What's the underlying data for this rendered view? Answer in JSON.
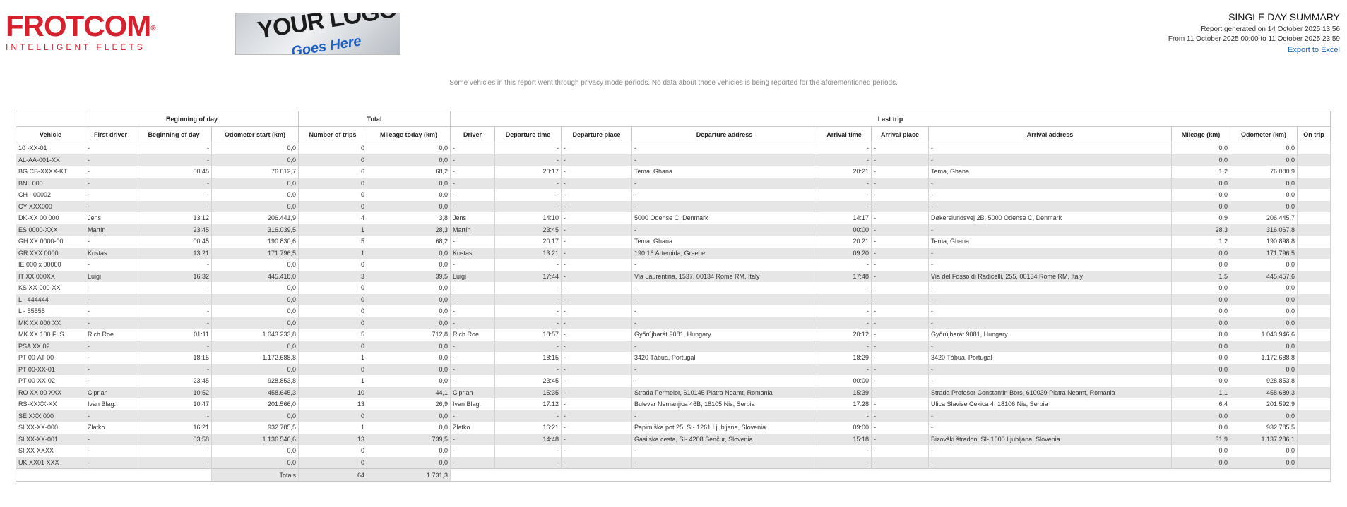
{
  "brand": {
    "name": "FROTCOM",
    "reg": "®",
    "tagline": "INTELLIGENT FLEETS"
  },
  "logo_placeholder": {
    "line1": "YOUR LOGO",
    "line2": "Goes Here"
  },
  "report": {
    "title": "SINGLE DAY SUMMARY",
    "generated": "Report generated on 14 October 2025 13:56",
    "range": "From 11 October 2025 00:00 to 11 October 2025 23:59",
    "export_label": "Export to Excel"
  },
  "notice": "Some vehicles in this report went through privacy mode periods. No data about those vehicles is being reported for the aforementioned periods.",
  "table": {
    "groups": {
      "beginning": "Beginning of day",
      "total": "Total",
      "last_trip": "Last trip"
    },
    "columns": [
      "Vehicle",
      "First driver",
      "Beginning of day",
      "Odometer start (km)",
      "Number of trips",
      "Mileage today (km)",
      "Driver",
      "Departure time",
      "Departure place",
      "Departure address",
      "Arrival time",
      "Arrival place",
      "Arrival address",
      "Mileage (km)",
      "Odometer (km)",
      "On trip"
    ],
    "rows": [
      [
        "10 -XX-01",
        "-",
        "-",
        "0,0",
        "0",
        "0,0",
        "-",
        "-",
        "-",
        "-",
        "-",
        "-",
        "-",
        "0,0",
        "0,0",
        ""
      ],
      [
        "AL-AA-001-XX",
        "-",
        "-",
        "0,0",
        "0",
        "0,0",
        "-",
        "-",
        "-",
        "-",
        "-",
        "-",
        "-",
        "0,0",
        "0,0",
        ""
      ],
      [
        "BG CB-XXXX-KT",
        "-",
        "00:45",
        "76.012,7",
        "6",
        "68,2",
        "-",
        "20:17",
        "-",
        "Tema, Ghana",
        "20:21",
        "-",
        "Tema, Ghana",
        "1,2",
        "76.080,9",
        ""
      ],
      [
        "BNL 000",
        "-",
        "-",
        "0,0",
        "0",
        "0,0",
        "-",
        "-",
        "-",
        "-",
        "-",
        "-",
        "-",
        "0,0",
        "0,0",
        ""
      ],
      [
        "CH - 00002",
        "-",
        "-",
        "0,0",
        "0",
        "0,0",
        "-",
        "-",
        "-",
        "-",
        "-",
        "-",
        "-",
        "0,0",
        "0,0",
        ""
      ],
      [
        "CY XXX000",
        "-",
        "-",
        "0,0",
        "0",
        "0,0",
        "-",
        "-",
        "-",
        "-",
        "-",
        "-",
        "-",
        "0,0",
        "0,0",
        ""
      ],
      [
        "DK-XX 00 000",
        "Jens",
        "13:12",
        "206.441,9",
        "4",
        "3,8",
        "Jens",
        "14:10",
        "-",
        "5000 Odense C, Denmark",
        "14:17",
        "-",
        "Døkerslundsvej 2B, 5000 Odense C, Denmark",
        "0,9",
        "206.445,7",
        ""
      ],
      [
        "ES 0000-XXX",
        "Martín",
        "23:45",
        "316.039,5",
        "1",
        "28,3",
        "Martín",
        "23:45",
        "-",
        "-",
        "00:00",
        "-",
        "-",
        "28,3",
        "316.067,8",
        ""
      ],
      [
        "GH XX 0000-00",
        "-",
        "00:45",
        "190.830,6",
        "5",
        "68,2",
        "-",
        "20:17",
        "-",
        "Tema, Ghana",
        "20:21",
        "-",
        "Tema, Ghana",
        "1,2",
        "190.898,8",
        ""
      ],
      [
        "GR XXX 0000",
        "Kostas",
        "13:21",
        "171.796,5",
        "1",
        "0,0",
        "Kostas",
        "13:21",
        "-",
        "190 16 Artemida, Greece",
        "09:20",
        "-",
        "-",
        "0,0",
        "171.796,5",
        ""
      ],
      [
        "IE 000 x 00000",
        "-",
        "-",
        "0,0",
        "0",
        "0,0",
        "-",
        "-",
        "-",
        "-",
        "-",
        "-",
        "-",
        "0,0",
        "0,0",
        ""
      ],
      [
        "IT XX 000XX",
        "Luigi",
        "16:32",
        "445.418,0",
        "3",
        "39,5",
        "Luigi",
        "17:44",
        "-",
        "Via Laurentina, 1537, 00134 Rome RM, Italy",
        "17:48",
        "-",
        "Via del Fosso di Radicelli, 255, 00134 Rome RM, Italy",
        "1,5",
        "445.457,6",
        ""
      ],
      [
        "KS XX-000-XX",
        "-",
        "-",
        "0,0",
        "0",
        "0,0",
        "-",
        "-",
        "-",
        "-",
        "-",
        "-",
        "-",
        "0,0",
        "0,0",
        ""
      ],
      [
        "L - 444444",
        "-",
        "-",
        "0,0",
        "0",
        "0,0",
        "-",
        "-",
        "-",
        "-",
        "-",
        "-",
        "-",
        "0,0",
        "0,0",
        ""
      ],
      [
        "L - 55555",
        "-",
        "-",
        "0,0",
        "0",
        "0,0",
        "-",
        "-",
        "-",
        "-",
        "-",
        "-",
        "-",
        "0,0",
        "0,0",
        ""
      ],
      [
        "MK XX 000 XX",
        "-",
        "-",
        "0,0",
        "0",
        "0,0",
        "-",
        "-",
        "-",
        "-",
        "-",
        "-",
        "-",
        "0,0",
        "0,0",
        ""
      ],
      [
        "MK XX 100 FLS",
        "Rich Roe",
        "01:11",
        "1.043.233,8",
        "5",
        "712,8",
        "Rich Roe",
        "18:57",
        "-",
        "Győrújbarát 9081, Hungary",
        "20:12",
        "-",
        "Győrújbarát 9081, Hungary",
        "0,0",
        "1.043.946,6",
        ""
      ],
      [
        "PSA XX 02",
        "-",
        "-",
        "0,0",
        "0",
        "0,0",
        "-",
        "-",
        "-",
        "-",
        "-",
        "-",
        "-",
        "0,0",
        "0,0",
        ""
      ],
      [
        "PT 00-AT-00",
        "-",
        "18:15",
        "1.172.688,8",
        "1",
        "0,0",
        "-",
        "18:15",
        "-",
        "3420 Tábua, Portugal",
        "18:29",
        "-",
        "3420 Tábua, Portugal",
        "0,0",
        "1.172.688,8",
        ""
      ],
      [
        "PT 00-XX-01",
        "-",
        "-",
        "0,0",
        "0",
        "0,0",
        "-",
        "-",
        "-",
        "-",
        "-",
        "-",
        "-",
        "0,0",
        "0,0",
        ""
      ],
      [
        "PT 00-XX-02",
        "-",
        "23:45",
        "928.853,8",
        "1",
        "0,0",
        "-",
        "23:45",
        "-",
        "-",
        "00:00",
        "-",
        "-",
        "0,0",
        "928.853,8",
        ""
      ],
      [
        "RO XX 00 XXX",
        "Ciprian",
        "10:52",
        "458.645,3",
        "10",
        "44,1",
        "Ciprian",
        "15:35",
        "-",
        "Strada Fermelor, 610145 Piatra Neamt, Romania",
        "15:39",
        "-",
        "Strada Profesor Constantin Bors, 610039 Piatra Neamt, Romania",
        "1,1",
        "458.689,3",
        ""
      ],
      [
        "RS-XXXX-XX",
        "Ivan Blag.",
        "10:47",
        "201.566,0",
        "13",
        "26,9",
        "Ivan Blag.",
        "17:12",
        "-",
        "Bulevar Nemanjica 46B, 18105 Nis, Serbia",
        "17:28",
        "-",
        "Ulica Slavise Cekica 4, 18106 Nis, Serbia",
        "6,4",
        "201.592,9",
        ""
      ],
      [
        "SE XXX 000",
        "-",
        "-",
        "0,0",
        "0",
        "0,0",
        "-",
        "-",
        "-",
        "-",
        "-",
        "-",
        "-",
        "0,0",
        "0,0",
        ""
      ],
      [
        "SI XX-XX-000",
        "Zlatko",
        "16:21",
        "932.785,5",
        "1",
        "0,0",
        "Zlatko",
        "16:21",
        "-",
        "Papimiška pot 25, SI- 1261 Ljubljana, Slovenia",
        "09:00",
        "-",
        "-",
        "0,0",
        "932.785,5",
        ""
      ],
      [
        "SI XX-XX-001",
        "-",
        "03:58",
        "1.136.546,6",
        "13",
        "739,5",
        "-",
        "14:48",
        "-",
        "Gasilska cesta, SI- 4208 Šenčur, Slovenia",
        "15:18",
        "-",
        "Bizovški štradon, SI- 1000 Ljubljana, Slovenia",
        "31,9",
        "1.137.286,1",
        ""
      ],
      [
        "SI XX-XXXX",
        "-",
        "-",
        "0,0",
        "0",
        "0,0",
        "-",
        "-",
        "-",
        "-",
        "-",
        "-",
        "-",
        "0,0",
        "0,0",
        ""
      ],
      [
        "UK XX01 XXX",
        "-",
        "-",
        "0,0",
        "0",
        "0,0",
        "-",
        "-",
        "-",
        "-",
        "-",
        "-",
        "-",
        "0,0",
        "0,0",
        ""
      ]
    ],
    "totals": {
      "label": "Totals",
      "trips": "64",
      "mileage": "1.731,3"
    }
  }
}
